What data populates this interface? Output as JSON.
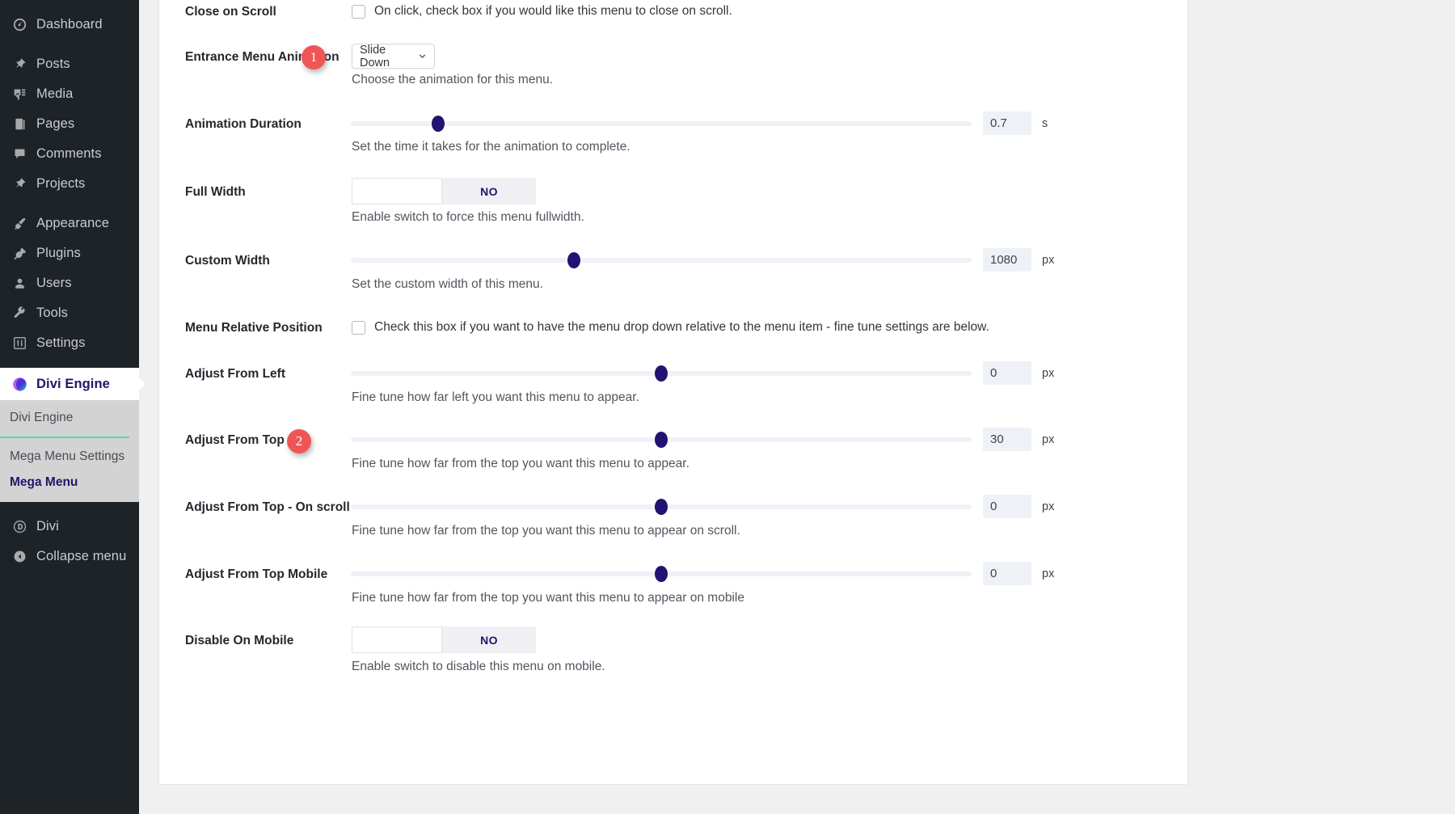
{
  "sidebar": {
    "items": [
      {
        "label": "Dashboard",
        "icon": "dashboard-icon"
      },
      {
        "label": "Posts",
        "icon": "pin-icon"
      },
      {
        "label": "Media",
        "icon": "media-icon"
      },
      {
        "label": "Pages",
        "icon": "pages-icon"
      },
      {
        "label": "Comments",
        "icon": "comment-icon"
      },
      {
        "label": "Projects",
        "icon": "pin-icon"
      },
      {
        "label": "Appearance",
        "icon": "brush-icon"
      },
      {
        "label": "Plugins",
        "icon": "plug-icon"
      },
      {
        "label": "Users",
        "icon": "user-icon"
      },
      {
        "label": "Tools",
        "icon": "wrench-icon"
      },
      {
        "label": "Settings",
        "icon": "sliders-icon"
      }
    ],
    "divi_engine": {
      "label": "Divi Engine",
      "icon": "divi-engine-logo-icon"
    },
    "submenu": [
      {
        "label": "Divi Engine",
        "active": false
      },
      {
        "label": "Mega Menu Settings",
        "active": false
      },
      {
        "label": "Mega Menu",
        "active": true
      }
    ],
    "footer": [
      {
        "label": "Divi",
        "icon": "divi-icon"
      },
      {
        "label": "Collapse menu",
        "icon": "collapse-arrow-icon"
      }
    ],
    "accent_green": "#4ce0a5",
    "active_purple": "#23146b"
  },
  "settings": {
    "close_on_scroll": {
      "label": "Close on Scroll",
      "checkbox_text": "On click, check box if you would like this menu to close on scroll.",
      "checked": false
    },
    "entrance_menu_animation": {
      "label": "Entrance Menu Animation",
      "value": "Slide Down",
      "description": "Choose the animation for this menu."
    },
    "animation_duration": {
      "label": "Animation Duration",
      "value": "0.7",
      "unit": "s",
      "description": "Set the time it takes for the animation to complete.",
      "percent": 14
    },
    "full_width": {
      "label": "Full Width",
      "state": "NO",
      "description": "Enable switch to force this menu fullwidth."
    },
    "custom_width": {
      "label": "Custom Width",
      "value": "1080",
      "unit": "px",
      "description": "Set the custom width of this menu.",
      "percent": 36
    },
    "menu_relative_position": {
      "label": "Menu Relative Position",
      "checkbox_text": "Check this box if you want to have the menu drop down relative to the menu item - fine tune settings are below.",
      "checked": false
    },
    "adjust_from_left": {
      "label": "Adjust From Left",
      "value": "0",
      "unit": "px",
      "description": "Fine tune how far left you want this menu to appear.",
      "percent": 50
    },
    "adjust_from_top": {
      "label": "Adjust From Top",
      "value": "30",
      "unit": "px",
      "description": "Fine tune how far from the top you want this menu to appear.",
      "percent": 50
    },
    "adjust_from_top_on_scroll": {
      "label": "Adjust From Top - On scroll",
      "value": "0",
      "unit": "px",
      "description": "Fine tune how far from the top you want this menu to appear on scroll.",
      "percent": 50
    },
    "adjust_from_top_mobile": {
      "label": "Adjust From Top Mobile",
      "value": "0",
      "unit": "px",
      "description": "Fine tune how far from the top you want this menu to appear on mobile",
      "percent": 50
    },
    "disable_on_mobile": {
      "label": "Disable On Mobile",
      "state": "NO",
      "description": "Enable switch to disable this menu on mobile."
    }
  },
  "callouts": [
    {
      "number": "1",
      "color": "#f05555"
    },
    {
      "number": "2",
      "color": "#f05555"
    }
  ]
}
